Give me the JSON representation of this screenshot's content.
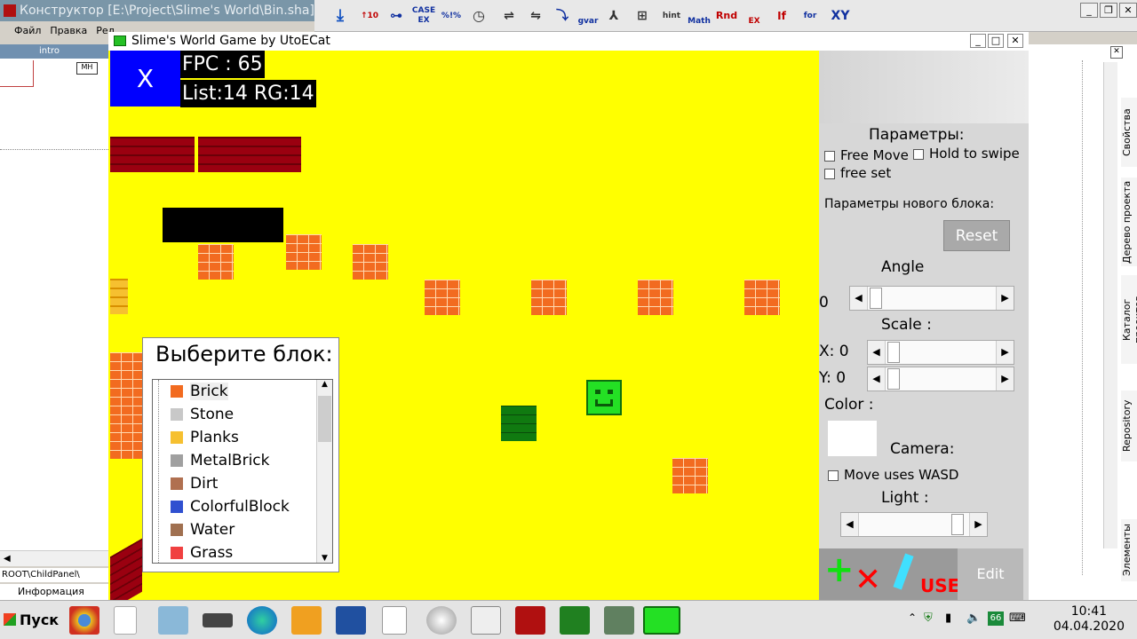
{
  "ide": {
    "title": "Конструктор [E:\\Project\\Slime's World\\Bin.sha]",
    "menu": [
      "Файл",
      "Правка",
      "Ред"
    ],
    "tab_label": "intro",
    "path": "ROOT\\ChildPanel\\",
    "info_tab": "Информация",
    "side_tabs": [
      "Свойства",
      "Дерево проекта",
      "Каталог проектов",
      "Repository",
      "Элементы"
    ],
    "toolbar_labels": [
      "CASE EX",
      "%!%",
      "gvar",
      "hint",
      "Math",
      "Rnd",
      "EX",
      "If",
      "for",
      "XY"
    ]
  },
  "game": {
    "window_title": "Slime's World Game by UtoECat",
    "x_label": "X",
    "fps_text": "FPC : 65",
    "list_text": "List:14 RG:14",
    "picker_title": "Выберите блок:",
    "blocks": [
      {
        "name": "Brick",
        "color": "#f26b20"
      },
      {
        "name": "Stone",
        "color": "#c8c8c8"
      },
      {
        "name": "Planks",
        "color": "#f6c030"
      },
      {
        "name": "MetalBrick",
        "color": "#a0a0a0"
      },
      {
        "name": "Dirt",
        "color": "#b07050"
      },
      {
        "name": "ColorfulBlock",
        "color": "#3050d0"
      },
      {
        "name": "Water",
        "color": "#a07050"
      },
      {
        "name": "Grass",
        "color": "#f04040"
      }
    ],
    "selected_block": "Brick"
  },
  "panel": {
    "params_title": "Параметры:",
    "free_move": "Free Move",
    "hold_to_swipe": "Hold to swipe",
    "free_set": "free set",
    "new_block_title": "Параметры нового блока:",
    "reset": "Reset",
    "angle": "Angle",
    "angle_value": "0",
    "scale": "Scale :",
    "x_scale": "X: 0",
    "y_scale": "Y: 0",
    "color_label": "Color :",
    "camera": "Camera:",
    "move_wasd": "Move uses WASD",
    "light": "Light :",
    "use_label": "USE",
    "edit_label": "Edit",
    "colors": {
      "reset_bg": "#a9a9a9",
      "edit_bg": "#b9b9b9"
    }
  },
  "taskbar": {
    "start": "Пуск",
    "time": "10:41",
    "date": "04.04.2020",
    "tray_badge": "66"
  }
}
